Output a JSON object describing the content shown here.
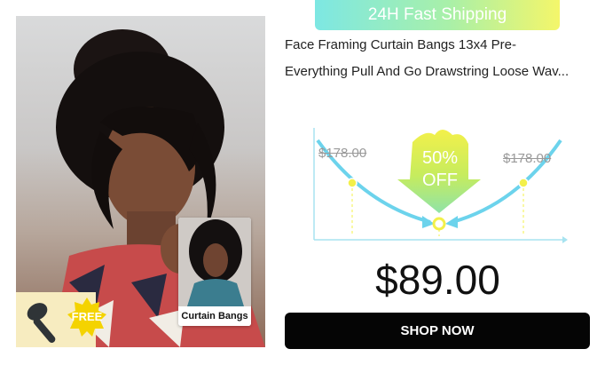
{
  "banner": {
    "text": "24H Fast Shipping"
  },
  "product": {
    "title_line1": "Face Framing Curtain Bangs 13x4 Pre-",
    "title_line2": "Everything Pull And Go Drawstring Loose Wav..."
  },
  "promo": {
    "free_label": "FREE",
    "inset_label": "Curtain Bangs",
    "discount_percent": "50%",
    "discount_word": "OFF",
    "original_price_left": "$178.00",
    "original_price_right": "$178.00"
  },
  "price": {
    "current": "$89.00"
  },
  "cta": {
    "label": "SHOP NOW"
  },
  "colors": {
    "banner_start": "#7de7e3",
    "banner_end": "#f4f66a",
    "graph_line": "#6cd3ec",
    "graph_dot": "#f3f04a",
    "button_bg": "#050505"
  }
}
